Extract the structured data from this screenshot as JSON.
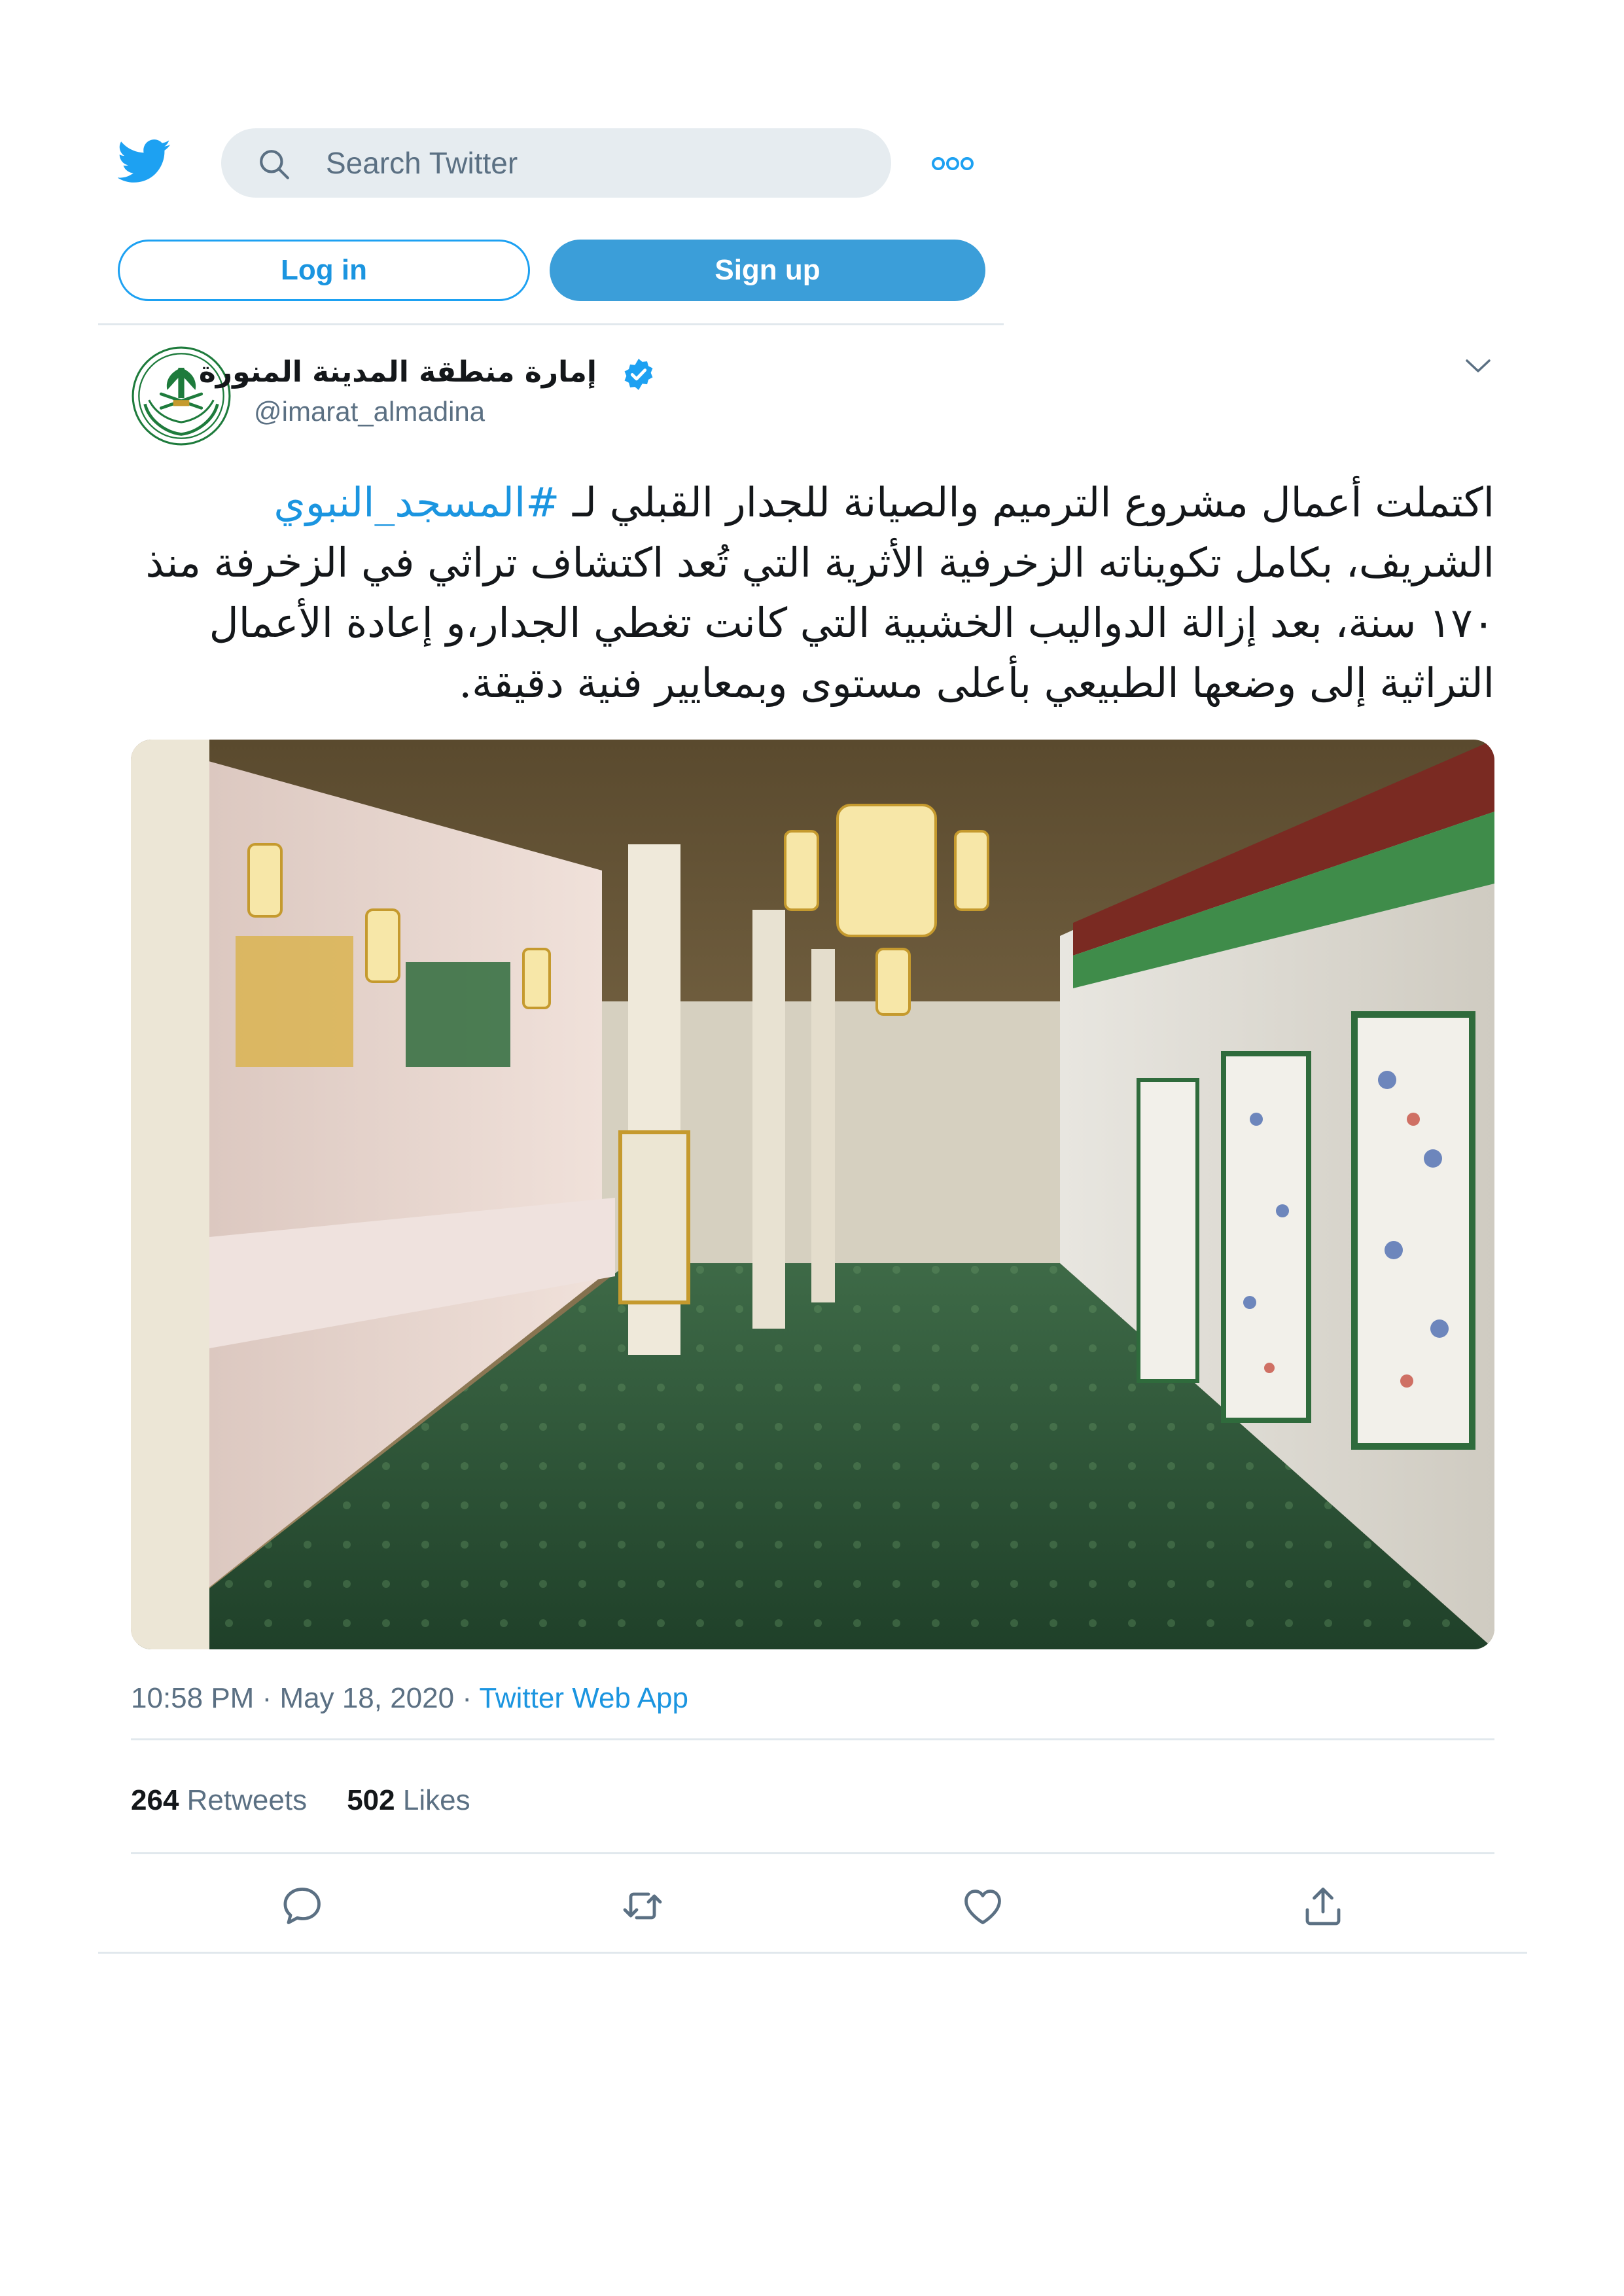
{
  "header": {
    "search_placeholder": "Search Twitter",
    "login_label": "Log in",
    "signup_label": "Sign up",
    "icons": [
      "twitter-bird-icon",
      "search-icon",
      "more-icon"
    ]
  },
  "author": {
    "display_name": "إمارة منطقة المدينة المنورة",
    "handle": "@imarat_almadina",
    "verified": true
  },
  "tweet": {
    "text_before": "اكتملت أعمال مشروع الترميم والصيانة للجدار القبلي لـ ",
    "hashtag": "#المسجد_النبوي",
    "text_after": " الشريف، بكامل تكويناته الزخرفية الأثرية التي تُعد اكتشاف تراثي في الزخرفة منذ ١٧٠ سنة، بعد إزالة الدواليب الخشبية التي كانت تغطي الجدار،و إعادة الأعمال التراثية إلى وضعها الطبيعي بأعلى مستوى وبمعايير فنية دقيقة.",
    "time": "10:58 PM",
    "date": "May 18, 2020",
    "separator": "·",
    "source": "Twitter Web App"
  },
  "stats": {
    "retweets_count": "264",
    "retweets_label": "Retweets",
    "likes_count": "502",
    "likes_label": "Likes"
  },
  "colors": {
    "brand": "#1da1f2",
    "link": "#1b95e0",
    "muted": "#5b7083",
    "divider": "#e1e8ed",
    "carpet": "#2f5a38"
  }
}
